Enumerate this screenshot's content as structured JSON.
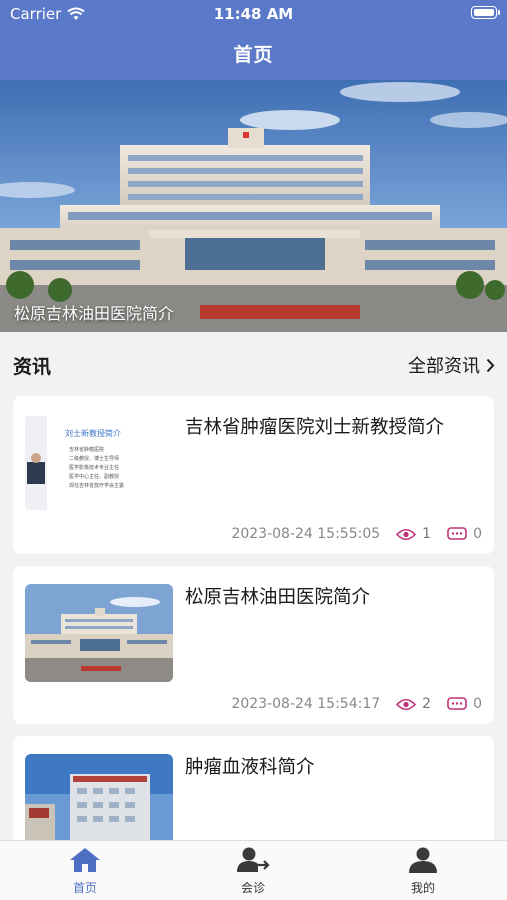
{
  "status": {
    "carrier": "Carrier",
    "time": "11:48 AM"
  },
  "nav": {
    "title": "首页"
  },
  "banner": {
    "caption": "松原吉林油田医院简介"
  },
  "section": {
    "title": "资讯",
    "more": "全部资讯"
  },
  "articles": [
    {
      "title": "吉林省肿瘤医院刘士新教授简介",
      "date": "2023-08-24 15:55:05",
      "views": "1",
      "comments": "0",
      "thumb": {
        "heading": "刘士新教授简介",
        "lines": [
          "吉林省肿瘤医院",
          "二级教授、博士生导师",
          "医学影像技术专业主任",
          "医学中心主任、副教授",
          "现任吉林省放疗学会主委"
        ]
      }
    },
    {
      "title": "松原吉林油田医院简介",
      "date": "2023-08-24 15:54:17",
      "views": "2",
      "comments": "0"
    },
    {
      "title": "肿瘤血液科简介"
    }
  ],
  "tabs": [
    {
      "label": "首页",
      "active": true
    },
    {
      "label": "会诊",
      "active": false
    },
    {
      "label": "我的",
      "active": false
    }
  ],
  "colors": {
    "primary": "#5a79c8",
    "accent": "#c0327a"
  }
}
